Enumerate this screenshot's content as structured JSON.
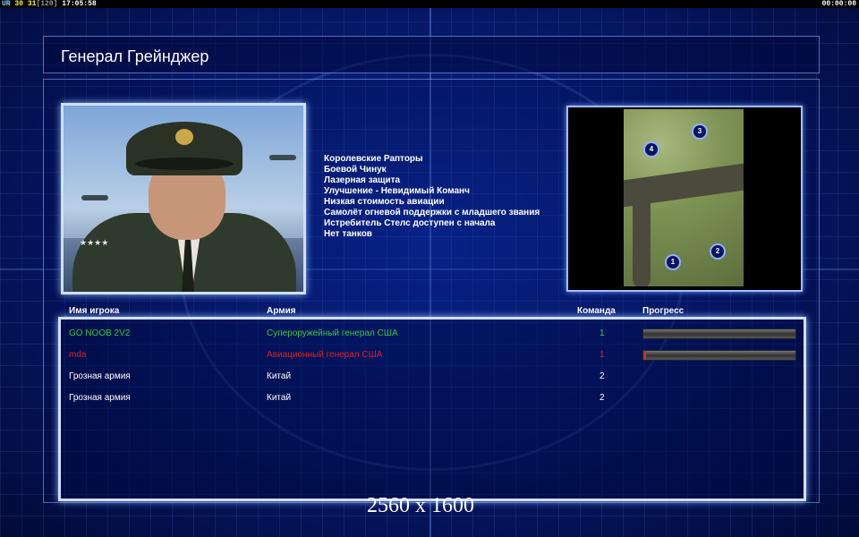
{
  "topbar": {
    "ur": "UR",
    "n1": "30",
    "n2": "31",
    "n3": "[120]",
    "clock": "17:05:58",
    "timer": "00:00:00"
  },
  "title": "Генерал Грейнджер",
  "portrait": {
    "insignia": "★★★★"
  },
  "features": [
    "Королевские Рапторы",
    "Боевой Чинук",
    "Лазерная защита",
    "Улучшение - Невидимый Команч",
    "Низкая стоимость авиации",
    "Самолёт огневой поддержки с младшего звания",
    "Истребитель Стелс доступен с начала",
    "Нет танков"
  ],
  "minimap": {
    "positions": [
      "1",
      "2",
      "3",
      "4"
    ]
  },
  "table": {
    "headers": {
      "name": "Имя игрока",
      "army": "Армия",
      "team": "Команда",
      "progress": "Прогресс"
    },
    "rows": [
      {
        "name": "GO NOOB 2V2",
        "army": "Супероружейный генерал США",
        "team": "1",
        "color": "#35c83a",
        "progress": 0.0
      },
      {
        "name": "mda",
        "army": "Авиационный генерал США",
        "team": "1",
        "color": "#e02020",
        "progress": 0.02
      },
      {
        "name": "Грозная армия",
        "army": "Китай",
        "team": "2",
        "color": "#ffffff",
        "progress": null
      },
      {
        "name": "Грозная армия",
        "army": "Китай",
        "team": "2",
        "color": "#ffffff",
        "progress": null
      }
    ]
  },
  "resolution": "2560 x 1600"
}
